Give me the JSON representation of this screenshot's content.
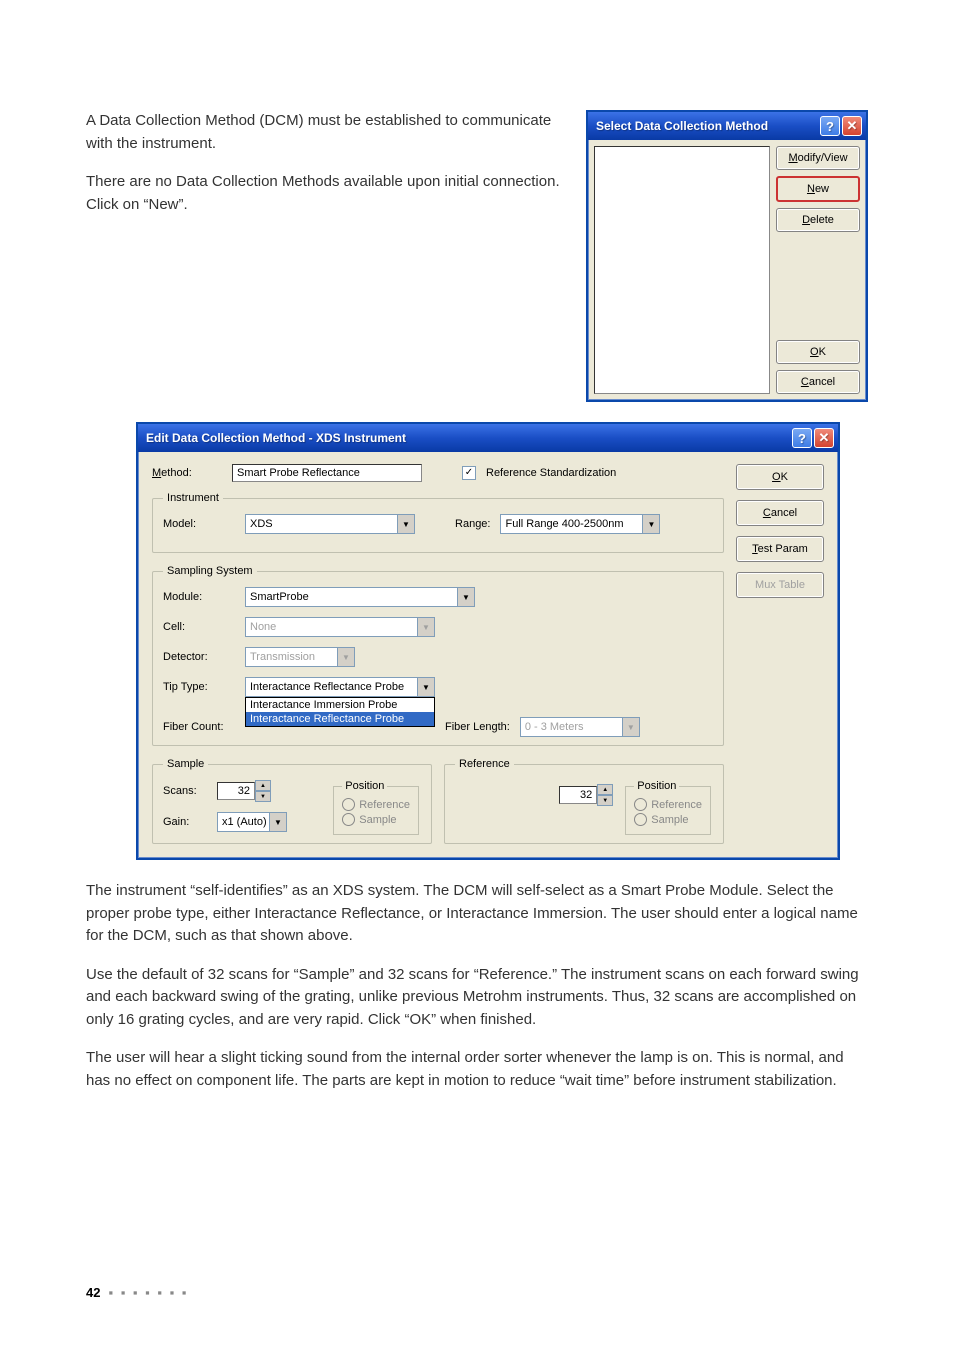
{
  "intro": {
    "p1": "A Data Collection Method (DCM) must be established to communicate with the instrument.",
    "p2": "There are no Data Collection Methods available upon initial connection. Click on “New”."
  },
  "small_dialog": {
    "title": "Select Data Collection Method",
    "buttons": {
      "modify": "Modify/View",
      "new": "New",
      "delete": "Delete",
      "ok": "OK",
      "cancel": "Cancel"
    }
  },
  "large_dialog": {
    "title": "Edit Data Collection Method - XDS Instrument",
    "method_label": "Method:",
    "method_value": "Smart Probe Reflectance",
    "ref_std_label": "Reference Standardization",
    "ok": "OK",
    "cancel": "Cancel",
    "test_param": "Test Param",
    "mux_table": "Mux Table",
    "instrument": {
      "legend": "Instrument",
      "model_label": "Model:",
      "model_value": "XDS",
      "range_label": "Range:",
      "range_value": "Full Range 400-2500nm"
    },
    "sampling": {
      "legend": "Sampling System",
      "module_label": "Module:",
      "module_value": "SmartProbe",
      "cell_label": "Cell:",
      "cell_value": "None",
      "detector_label": "Detector:",
      "detector_value": "Transmission",
      "tip_label": "Tip Type:",
      "tip_value": "Interactance Reflectance Probe",
      "tip_options": [
        "Interactance Immersion Probe",
        "Interactance Reflectance Probe"
      ],
      "fiber_count_label": "Fiber Count:",
      "fiber_length_label": "Fiber Length:",
      "fiber_length_value": "0 - 3 Meters"
    },
    "sample": {
      "legend": "Sample",
      "scans_label": "Scans:",
      "scans_value": "32",
      "gain_label": "Gain:",
      "gain_value": "x1 (Auto)",
      "position_legend": "Position",
      "pos_ref": "Reference",
      "pos_sample": "Sample"
    },
    "reference": {
      "legend": "Reference",
      "scans_value": "32",
      "position_legend": "Position",
      "pos_ref": "Reference",
      "pos_sample": "Sample"
    }
  },
  "body": {
    "p1": "The instrument “self-identifies” as an XDS system. The DCM will self-select as a Smart Probe Module. Select the proper probe type, either Interactance Reflectance, or Interactance Immersion. The user should enter a logical name for the DCM, such as that shown above.",
    "p2": "Use the default of 32 scans for “Sample” and 32 scans for “Reference.” The instrument scans on each forward swing and each backward swing of the grating, unlike previous Metrohm instruments. Thus, 32 scans are accomplished on only 16 grating cycles, and are very rapid. Click “OK” when finished.",
    "p3": "The user will hear a slight ticking sound from the internal order sorter whenever the lamp is on. This is normal, and has no effect on component life. The parts are kept in motion to reduce “wait time” before instrument stabilization."
  },
  "footer": {
    "page": "42",
    "dots": "▪ ▪ ▪ ▪ ▪ ▪ ▪"
  }
}
